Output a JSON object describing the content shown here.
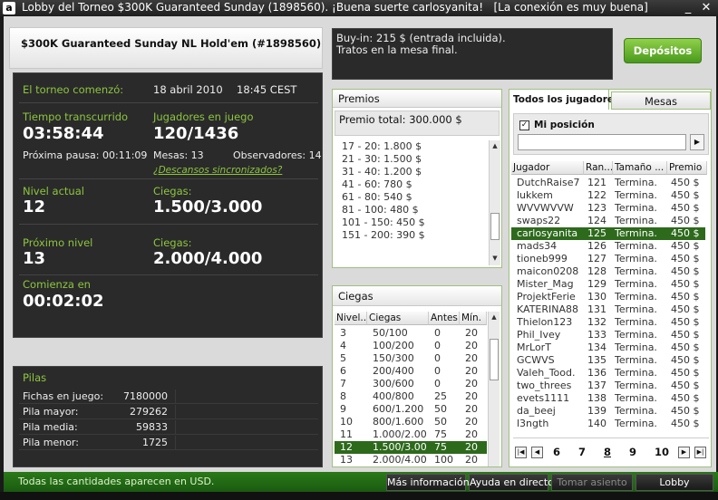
{
  "window": {
    "title": "Lobby del Torneo $300K Guaranteed Sunday (1898560). ¡Buena suerte carlosyanita!",
    "connection": "[La conexión es muy buena]",
    "logo": "a"
  },
  "header": {
    "title": "$300K Guaranteed Sunday NL Hold'em (#1898560)"
  },
  "info": {
    "started_label": "El torneo comenzó:",
    "started_value": "18 abril 2010",
    "started_time": "18:45 CEST",
    "elapsed_label": "Tiempo transcurrido",
    "elapsed_value": "03:58:44",
    "players_label": "Jugadores en juego",
    "players_value": "120/1436",
    "next_break_label": "Próxima pausa: 00:11:09",
    "tables_label": "Mesas: 13",
    "observers_label": "Observadores: 14",
    "sync_breaks_link": "¿Descansos sincronizados?",
    "level_label": "Nivel actual",
    "level_value": "12",
    "blinds_label": "Ciegas:",
    "blinds_value": "1.500/3.000",
    "next_level_label": "Próximo nivel",
    "next_level_value": "13",
    "next_blinds_label": "Ciegas:",
    "next_blinds_value": "2.000/4.000",
    "starts_in_label": "Comienza en",
    "starts_in_value": "00:02:02"
  },
  "stacks": {
    "title": "Pilas",
    "rows": [
      {
        "label": "Fichas en juego:",
        "value": "7180000"
      },
      {
        "label": "Pila mayor:",
        "value": "279262"
      },
      {
        "label": "Pila media:",
        "value": "59833"
      },
      {
        "label": "Pila menor:",
        "value": "1725"
      }
    ]
  },
  "buyin": {
    "line1": "Buy-in: 215 $ (entrada incluida).",
    "line2": "Tratos en la mesa final.",
    "deposit_button": "Depósitos"
  },
  "prizes": {
    "title": "Premios",
    "total": "Premio total: 300.000 $",
    "rows": [
      "17 - 20: 1.800 $",
      "21 - 30: 1.500 $",
      "31 - 40: 1.200 $",
      "41 - 60: 780 $",
      "61 - 80: 540 $",
      "81 - 100: 480 $",
      "101 - 150: 450 $",
      "151 - 200: 390 $"
    ]
  },
  "blinds": {
    "title": "Ciegas",
    "columns": [
      "Nivel...",
      "Ciegas",
      "Antes",
      "Mín."
    ],
    "rows": [
      [
        "3",
        "50/100",
        "0",
        "20"
      ],
      [
        "4",
        "100/200",
        "0",
        "20"
      ],
      [
        "5",
        "150/300",
        "0",
        "20"
      ],
      [
        "6",
        "200/400",
        "0",
        "20"
      ],
      [
        "7",
        "300/600",
        "0",
        "20"
      ],
      [
        "8",
        "400/800",
        "25",
        "20"
      ],
      [
        "9",
        "600/1.200",
        "50",
        "20"
      ],
      [
        "10",
        "800/1.600",
        "50",
        "20"
      ],
      [
        "11",
        "1.000/2.00",
        "75",
        "20"
      ],
      [
        "12",
        "1.500/3.00",
        "75",
        "20"
      ],
      [
        "13",
        "2.000/4.00",
        "100",
        "20"
      ]
    ],
    "selected_index": 9
  },
  "players": {
    "tab_all": "Todos los jugadores",
    "tab_tables": "Mesas",
    "my_position": "Mi posición",
    "search_value": "",
    "columns": [
      "Jugador",
      "Ran...",
      "Tamaño ...",
      "Premio"
    ],
    "rows": [
      [
        "DutchRaise7",
        "121",
        "Termina.",
        "450 $"
      ],
      [
        "lukkem",
        "122",
        "Termina.",
        "450 $"
      ],
      [
        "WVVWVVW",
        "123",
        "Termina.",
        "450 $"
      ],
      [
        "swaps22",
        "124",
        "Termina.",
        "450 $"
      ],
      [
        "carlosyanita",
        "125",
        "Termina.",
        "450 $"
      ],
      [
        "mads34",
        "126",
        "Termina.",
        "450 $"
      ],
      [
        "tioneb999",
        "127",
        "Termina.",
        "450 $"
      ],
      [
        "maicon0208",
        "128",
        "Termina.",
        "450 $"
      ],
      [
        "Mister_Mag",
        "129",
        "Termina.",
        "450 $"
      ],
      [
        "ProjektFerie",
        "130",
        "Termina.",
        "450 $"
      ],
      [
        "KATERINA88",
        "131",
        "Termina.",
        "450 $"
      ],
      [
        "Thielon123",
        "132",
        "Termina.",
        "450 $"
      ],
      [
        "Phil_Ivey",
        "133",
        "Termina.",
        "450 $"
      ],
      [
        "MrLorT",
        "134",
        "Termina.",
        "450 $"
      ],
      [
        "GCWVS",
        "135",
        "Termina.",
        "450 $"
      ],
      [
        "Valeh_Tood.",
        "136",
        "Termina.",
        "450 $"
      ],
      [
        "two_threes",
        "137",
        "Termina.",
        "450 $"
      ],
      [
        "evets1111",
        "138",
        "Termina.",
        "450 $"
      ],
      [
        "da_beej",
        "139",
        "Termina.",
        "450 $"
      ],
      [
        "l3ngth",
        "140",
        "Termina.",
        "450 $"
      ]
    ],
    "selected_index": 4,
    "pages": [
      "6",
      "7",
      "8",
      "9",
      "10"
    ],
    "current_page": "8"
  },
  "footer": {
    "note": "Todas las cantidades aparecen en USD.",
    "more_info": "Más información",
    "help": "Ayuda en directo",
    "take_seat": "Tomar asiento",
    "lobby": "Lobby"
  },
  "colors": {
    "accent": "#8cc63f",
    "selected_row": "#2d6a1c",
    "panel_dark": "#2a2a2a"
  }
}
